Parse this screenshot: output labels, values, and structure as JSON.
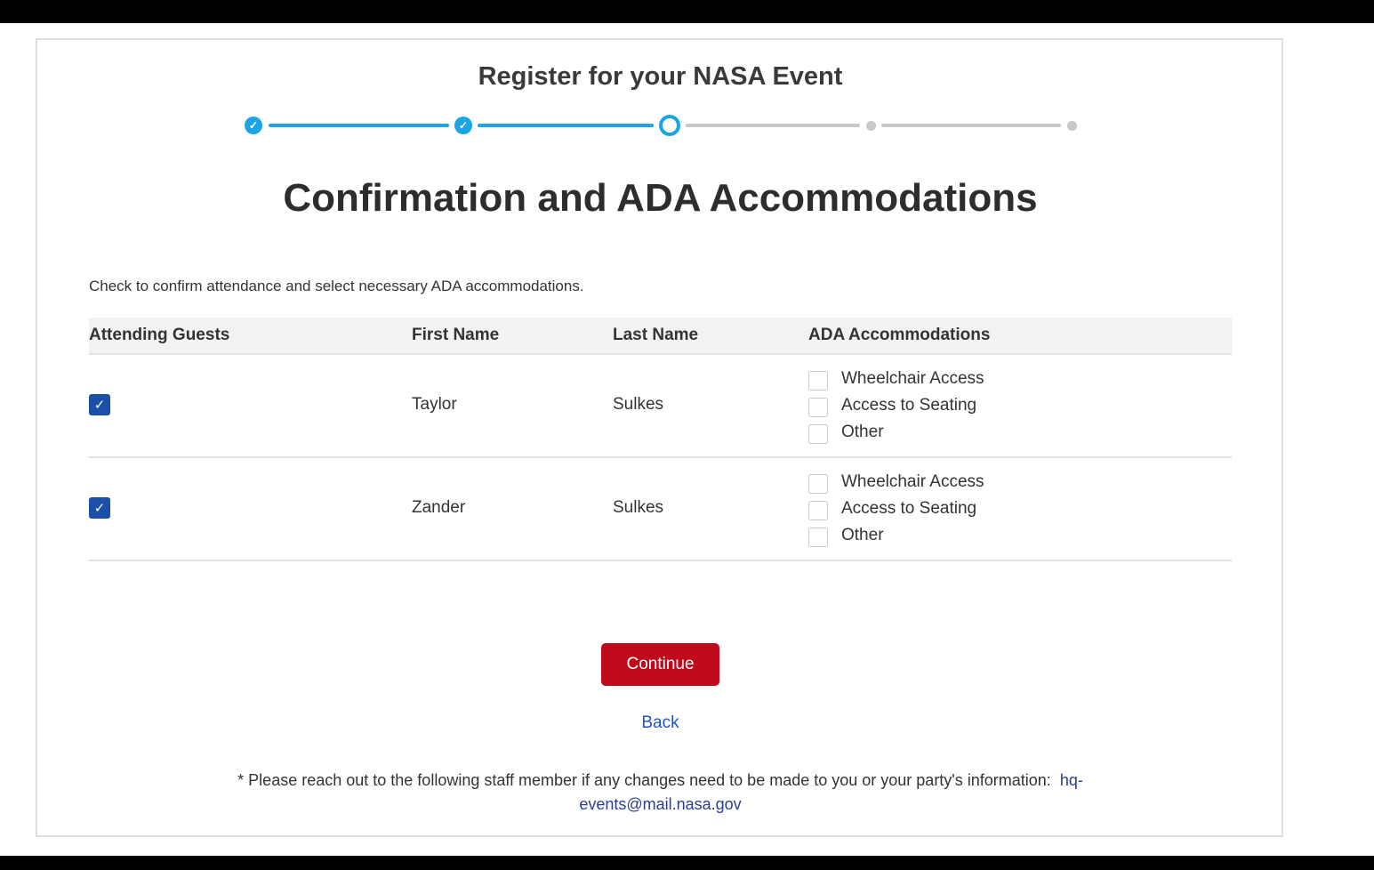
{
  "header": {
    "event_title": "Register for your NASA Event"
  },
  "stepper": {
    "steps": [
      {
        "status": "completed"
      },
      {
        "status": "completed"
      },
      {
        "status": "current"
      },
      {
        "status": "upcoming"
      },
      {
        "status": "upcoming"
      }
    ]
  },
  "section": {
    "title": "Confirmation and ADA Accommodations",
    "instructions": "Check to confirm attendance and select necessary ADA accommodations."
  },
  "table": {
    "headers": [
      "Attending Guests",
      "First Name",
      "Last Name",
      "ADA Accommodations"
    ],
    "rows": [
      {
        "attending": true,
        "first_name": "Taylor",
        "last_name": "Sulkes",
        "options": [
          {
            "label": "Wheelchair Access",
            "checked": false
          },
          {
            "label": "Access to Seating",
            "checked": false
          },
          {
            "label": "Other",
            "checked": false
          }
        ]
      },
      {
        "attending": true,
        "first_name": "Zander",
        "last_name": "Sulkes",
        "options": [
          {
            "label": "Wheelchair Access",
            "checked": false
          },
          {
            "label": "Access to Seating",
            "checked": false
          },
          {
            "label": "Other",
            "checked": false
          }
        ]
      }
    ]
  },
  "actions": {
    "continue_label": "Continue",
    "back_label": "Back"
  },
  "footer": {
    "note": "* Please reach out to the following staff member if any changes need to be made to you or your party's information:",
    "email": "hq-events@mail.nasa.gov"
  },
  "colors": {
    "accent_blue": "#1ba4e8",
    "checkbox_blue": "#1c4fa8",
    "continue_red": "#c0091b",
    "link_blue": "#2056c4"
  }
}
